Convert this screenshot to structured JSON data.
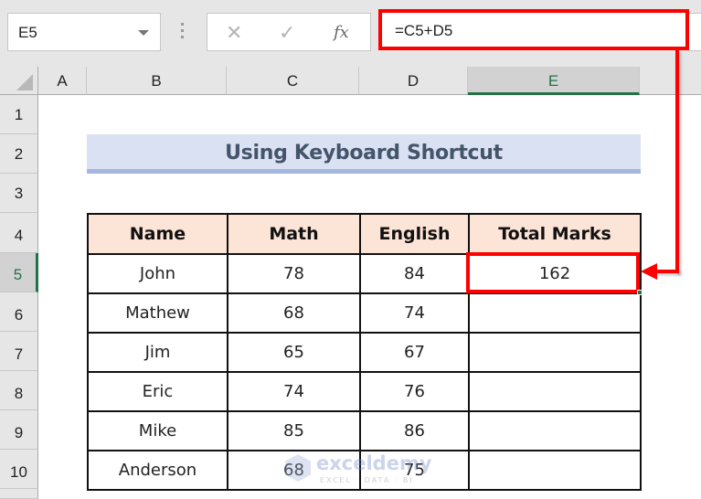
{
  "formula_bar": {
    "name_box": "E5",
    "formula": "=C5+D5",
    "icons": {
      "cancel": "✕",
      "enter": "✓",
      "insert_function": "fx"
    }
  },
  "columns": [
    "A",
    "B",
    "C",
    "D",
    "E"
  ],
  "selected_column": "E",
  "rows": [
    "1",
    "2",
    "3",
    "4",
    "5",
    "6",
    "7",
    "8",
    "9",
    "10"
  ],
  "selected_row": "5",
  "sheet": {
    "title": "Using Keyboard Shortcut",
    "table": {
      "headers": [
        "Name",
        "Math",
        "English",
        "Total Marks"
      ],
      "rows": [
        [
          "John",
          "78",
          "84",
          "162"
        ],
        [
          "Mathew",
          "68",
          "74",
          ""
        ],
        [
          "Jim",
          "65",
          "67",
          ""
        ],
        [
          "Eric",
          "74",
          "76",
          ""
        ],
        [
          "Mike",
          "85",
          "86",
          ""
        ],
        [
          "Anderson",
          "68",
          "75",
          ""
        ]
      ]
    }
  },
  "watermark": {
    "brand": "exceldemy",
    "tagline": "EXCEL · DATA · BI"
  },
  "colors": {
    "highlight": "#ff0000",
    "excel_green": "#217346",
    "title_bg": "#d9e1f2",
    "header_bg": "#fce4d6"
  }
}
